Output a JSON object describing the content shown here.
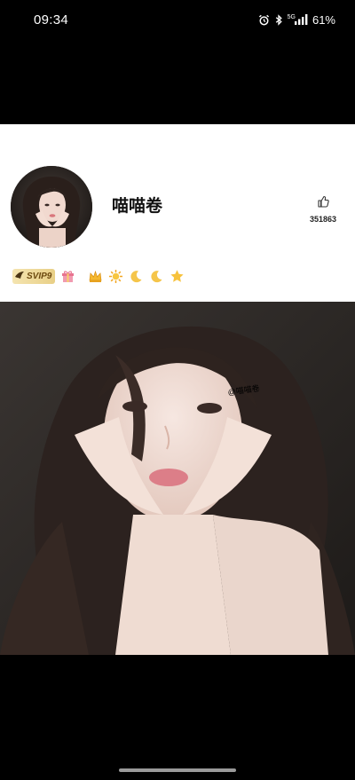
{
  "status_bar": {
    "time": "09:34",
    "network": "5G",
    "battery": "61%",
    "icons": [
      "alarm-icon",
      "bluetooth-icon",
      "signal-icon"
    ]
  },
  "profile": {
    "username": "喵喵卷",
    "like_count": "351863",
    "svip_label": "SVIP9",
    "badges": [
      "crown-icon",
      "sun-icon",
      "moon-icon",
      "moon-icon",
      "star-icon"
    ]
  },
  "photo": {
    "watermark": "@喵喵卷"
  },
  "colors": {
    "status_bar_bg": "#000000",
    "card_bg": "#ffffff",
    "svip_gold": "#e8cf86"
  }
}
